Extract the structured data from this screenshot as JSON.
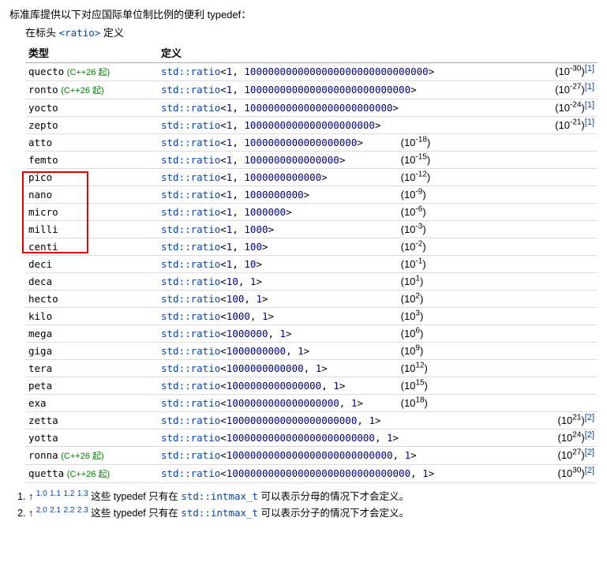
{
  "intro": "标准库提供以下对应国际单位制比例的便利 typedef：",
  "defined_in_prefix": "在标头 ",
  "defined_in_header": "<ratio>",
  "defined_in_suffix": " 定义",
  "columns": {
    "type": "类型",
    "def": "定义"
  },
  "mark": "(C++26 起)",
  "ratio_prefix": "std::ratio",
  "items": [
    {
      "name": "quecto",
      "mark": true,
      "num": "1",
      "den": "1000000000000000000000000000000",
      "exp": "-30",
      "ref": "[1]"
    },
    {
      "name": "ronto",
      "mark": true,
      "num": "1",
      "den": "1000000000000000000000000000",
      "exp": "-27",
      "ref": "[1]"
    },
    {
      "name": "yocto",
      "mark": false,
      "num": "1",
      "den": "1000000000000000000000000",
      "exp": "-24",
      "ref": "[1]"
    },
    {
      "name": "zepto",
      "mark": false,
      "num": "1",
      "den": "1000000000000000000000",
      "exp": "-21",
      "ref": "[1]"
    },
    {
      "name": "atto",
      "mark": false,
      "num": "1",
      "den": "1000000000000000000",
      "exp": "-18",
      "ref": null
    },
    {
      "name": "femto",
      "mark": false,
      "num": "1",
      "den": "1000000000000000",
      "exp": "-15",
      "ref": null
    },
    {
      "name": "pico",
      "mark": false,
      "num": "1",
      "den": "1000000000000",
      "exp": "-12",
      "ref": null
    },
    {
      "name": "nano",
      "mark": false,
      "num": "1",
      "den": "1000000000",
      "exp": "-9",
      "ref": null
    },
    {
      "name": "micro",
      "mark": false,
      "num": "1",
      "den": "1000000",
      "exp": "-6",
      "ref": null
    },
    {
      "name": "milli",
      "mark": false,
      "num": "1",
      "den": "1000",
      "exp": "-3",
      "ref": null
    },
    {
      "name": "centi",
      "mark": false,
      "num": "1",
      "den": "100",
      "exp": "-2",
      "ref": null
    },
    {
      "name": "deci",
      "mark": false,
      "num": "1",
      "den": "10",
      "exp": "-1",
      "ref": null
    },
    {
      "name": "deca",
      "mark": false,
      "num": "10",
      "den": "1",
      "exp": "1",
      "ref": null
    },
    {
      "name": "hecto",
      "mark": false,
      "num": "100",
      "den": "1",
      "exp": "2",
      "ref": null
    },
    {
      "name": "kilo",
      "mark": false,
      "num": "1000",
      "den": "1",
      "exp": "3",
      "ref": null
    },
    {
      "name": "mega",
      "mark": false,
      "num": "1000000",
      "den": "1",
      "exp": "6",
      "ref": null
    },
    {
      "name": "giga",
      "mark": false,
      "num": "1000000000",
      "den": "1",
      "exp": "9",
      "ref": null
    },
    {
      "name": "tera",
      "mark": false,
      "num": "1000000000000",
      "den": "1",
      "exp": "12",
      "ref": null
    },
    {
      "name": "peta",
      "mark": false,
      "num": "1000000000000000",
      "den": "1",
      "exp": "15",
      "ref": null
    },
    {
      "name": "exa",
      "mark": false,
      "num": "1000000000000000000",
      "den": "1",
      "exp": "18",
      "ref": null
    },
    {
      "name": "zetta",
      "mark": false,
      "num": "1000000000000000000000",
      "den": "1",
      "exp": "21",
      "ref": "[2]"
    },
    {
      "name": "yotta",
      "mark": false,
      "num": "1000000000000000000000000",
      "den": "1",
      "exp": "24",
      "ref": "[2]"
    },
    {
      "name": "ronna",
      "mark": true,
      "num": "1000000000000000000000000000",
      "den": "1",
      "exp": "27",
      "ref": "[2]"
    },
    {
      "name": "quetta",
      "mark": true,
      "num": "1000000000000000000000000000000",
      "den": "1",
      "exp": "30",
      "ref": "[2]"
    }
  ],
  "footnotes": [
    {
      "backrefs": [
        "1.0",
        "1.1",
        "1.2",
        "1.3"
      ],
      "prefix": "这些 typedef 只有在 ",
      "code": "std::intmax_t",
      "suffix": " 可以表示分母的情况下才会定义。"
    },
    {
      "backrefs": [
        "2.0",
        "2.1",
        "2.2",
        "2.3"
      ],
      "prefix": "这些 typedef 只有在 ",
      "code": "std::intmax_t",
      "suffix": " 可以表示分子的情况下才会定义。"
    }
  ]
}
